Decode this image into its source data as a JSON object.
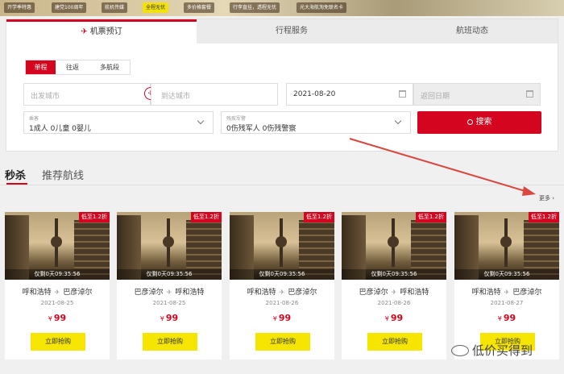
{
  "promo": {
    "items": [
      "开学季特惠",
      "建党100周年",
      "航机传媒",
      "全程无忧",
      "多价格套餐",
      "行李直挂，透程无忧",
      "光大海航淘免联名卡"
    ]
  },
  "booking": {
    "tabs": [
      "机票预订",
      "行程服务",
      "航班动态"
    ],
    "trip_types": [
      "单程",
      "往返",
      "多航段"
    ],
    "from_placeholder": "出发城市",
    "to_placeholder": "到达城市",
    "depart_date": "2021-08-20",
    "return_placeholder": "返回日期",
    "passenger_label": "乘客",
    "passenger_value": "1成人  0儿童  0婴儿",
    "special_label": "残疾军警",
    "special_value": "0伤残军人  0伤残警察",
    "search_label": "搜索"
  },
  "section": {
    "tab_active": "秒杀",
    "tab_inactive": "推荐航线",
    "more": "更多 ›"
  },
  "deals": [
    {
      "from": "呼和浩特",
      "to": "巴彦淖尔",
      "date": "2021-08-25",
      "price": "99",
      "discount": "低至1.2折",
      "countdown": "仅剩0天09:35:56",
      "buy": "立即抢购"
    },
    {
      "from": "巴彦淖尔",
      "to": "呼和浩特",
      "date": "2021-08-25",
      "price": "99",
      "discount": "低至1.2折",
      "countdown": "仅剩0天09:35:56",
      "buy": "立即抢购"
    },
    {
      "from": "呼和浩特",
      "to": "巴彦淖尔",
      "date": "2021-08-26",
      "price": "99",
      "discount": "低至1.2折",
      "countdown": "仅剩0天09:35:56",
      "buy": "立即抢购"
    },
    {
      "from": "巴彦淖尔",
      "to": "呼和浩特",
      "date": "2021-08-26",
      "price": "99",
      "discount": "低至1.2折",
      "countdown": "仅剩0天09:35:56",
      "buy": "立即抢购"
    },
    {
      "from": "呼和浩特",
      "to": "巴彦淖尔",
      "date": "2021-08-27",
      "price": "99",
      "discount": "低至1.2折",
      "countdown": "仅剩0天09:35:56",
      "buy": "立即抢购"
    }
  ],
  "currency": "¥",
  "watermark": "低价买得到",
  "colors": {
    "accent": "#d4061f",
    "buy": "#f5e500",
    "arrow": "#d9473f"
  }
}
